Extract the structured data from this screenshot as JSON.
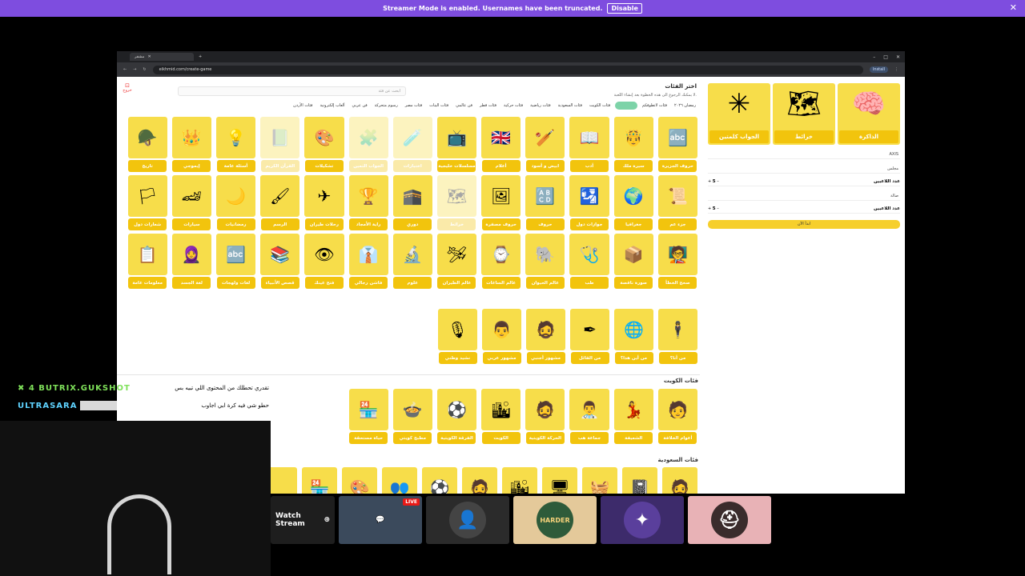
{
  "banner": {
    "text": "Streamer Mode is enabled. Usernames have been truncated.",
    "button": "Disable",
    "close": "✕"
  },
  "browser": {
    "tab_title": "مشفر",
    "url": "eikhmid.com/create-game",
    "install": "Install"
  },
  "page": {
    "back_label": "خروج",
    "title": "اختر الفئات",
    "subtitle": "لا يمكنك الرجوع الى هذه الخطوة بعد إنشاء اللعبة.",
    "search_placeholder": "ابحث عن فئة",
    "categories": [
      "رمضان ٢٠٢٦",
      "فئات لاتطوفكم",
      "فئات عامة",
      "فئات الكويت",
      "فئات السعودية",
      "فئات رياضية",
      "فئات حركية",
      "فئات قطر",
      "فن عالمي",
      "فئات البنات",
      "فئات مصر",
      "رسوم متحركة",
      "فن عربي",
      "ألعاب إلكترونية",
      "فئات الأردن"
    ],
    "grid_row1": [
      "حروف الجزيرة",
      "سيرة ملك",
      "أدب",
      "ابيض و أسود",
      "أعلام",
      "مسلسلات خليجية",
      "اختبارات",
      "الجواب الثمين",
      "تشكيلات",
      "القرآن الكريم",
      "أسئلة عامة",
      "إيموجي",
      "تاريخ"
    ],
    "grid_row2": [
      "جزء عم",
      "جغرافيا",
      "جوازات دول",
      "حروف",
      "حروف مصفرة",
      "خرائط",
      "دوري",
      "راية الأمجاد",
      "رحلات طيران",
      "الرسم",
      "رمضانيات",
      "سيارات",
      "شعارات دول"
    ],
    "grid_row3": [
      "صحح الخطأ",
      "صورة ناقصة",
      "طب",
      "عالم الحيوان",
      "عالم الساعات",
      "عالم الطيران",
      "علوم",
      "فاشن رجالي",
      "فتح عينك",
      "قصص الأنبياء",
      "لغات ولهجات",
      "لغة الجسد",
      "معلومات عامة"
    ],
    "grid_row4": [
      "من أنا؟",
      "من أين هذا؟",
      "من القائل",
      "مشهور أجنبي",
      "مشهور عربي",
      "نشيد وطني"
    ],
    "kuwait_title": "فئات الكويت",
    "kuwait": [
      "أعوام الخلافة",
      "الشعيفة",
      "جماعة هب",
      "الحركة الكويتية",
      "الكويت",
      "الفرقة الكويتية",
      "مطبخ كويتي",
      "حياة مستحقة"
    ],
    "saudi_title": "فئات السعودية",
    "saudi": [
      "",
      "",
      "",
      "",
      "",
      "",
      "",
      "",
      "",
      "",
      "",
      ""
    ],
    "side": {
      "big": [
        {
          "label": "الذاكرة",
          "icon": "🧠"
        },
        {
          "label": "خرائط",
          "icon": "🗺"
        },
        {
          "label": "الجواب كلمتين",
          "icon": "✳"
        }
      ],
      "axis": "AXIS",
      "team1": "مجلس",
      "players_label1": "عدد اللاعبين",
      "count1": "5",
      "team2": "صالة",
      "players_label2": "عدد اللاعبين",
      "count2": "5",
      "start": "ابدأ الآن"
    }
  },
  "chat": [
    {
      "user": "✖ 4 BUTRIX.GUKSHOT",
      "text": "تقدري تحطلك من المحتوى اللي تبيه بس"
    },
    {
      "user": "ULTRASARA",
      "text": "حطو شي فيه كرة ابي اجاوب"
    }
  ],
  "thumbs": {
    "watch": "Watch Stream",
    "live": "LIVE",
    "harder": "HARDER"
  }
}
